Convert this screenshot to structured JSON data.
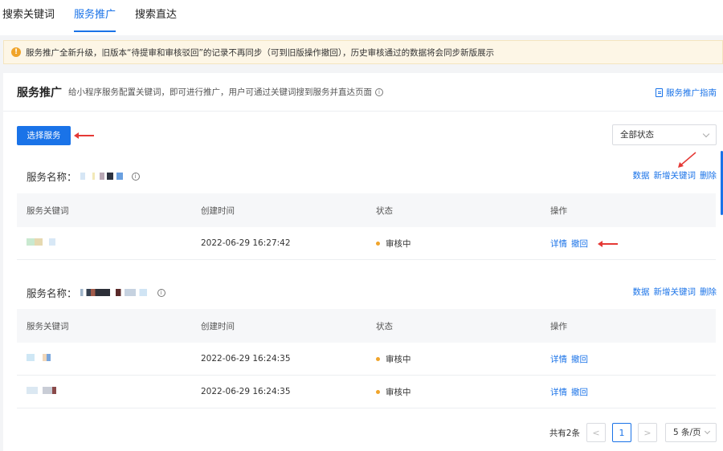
{
  "tabs": [
    {
      "label": "搜索关键词",
      "active": false
    },
    {
      "label": "服务推广",
      "active": true
    },
    {
      "label": "搜索直达",
      "active": false
    }
  ],
  "notice": {
    "icon": "warning-icon",
    "text": "服务推广全新升级，旧版本“待提审和审核驳回”的记录不再同步（可到旧版操作撤回），历史审核通过的数据将会同步新版展示"
  },
  "card": {
    "title": "服务推广",
    "desc": "给小程序服务配置关键词，即可进行推广，用户可通过关键词搜到服务并直达页面",
    "guide": "服务推广指南",
    "select_button": "选择服务",
    "status_filter": "全部状态"
  },
  "columns": [
    "服务关键词",
    "创建时间",
    "状态",
    "操作"
  ],
  "services": [
    {
      "label": "服务名称：",
      "actions": [
        "数据",
        "新增关键词",
        "删除"
      ],
      "rows": [
        {
          "time": "2022-06-29 16:27:42",
          "status": "审核中",
          "ops": [
            "详情",
            "撤回"
          ]
        }
      ]
    },
    {
      "label": "服务名称：",
      "actions": [
        "数据",
        "新增关键词",
        "删除"
      ],
      "rows": [
        {
          "time": "2022-06-29 16:24:35",
          "status": "审核中",
          "ops": [
            "详情",
            "撤回"
          ]
        },
        {
          "time": "2022-06-29 16:24:35",
          "status": "审核中",
          "ops": [
            "详情",
            "撤回"
          ]
        }
      ]
    }
  ],
  "pager": {
    "total": "共有2条",
    "current": "1",
    "prev": "<",
    "next": ">",
    "size": "5 条/页"
  },
  "colors": {
    "accent": "#1a73e8",
    "warning": "#f0a42a",
    "annotation": "#e53935"
  }
}
